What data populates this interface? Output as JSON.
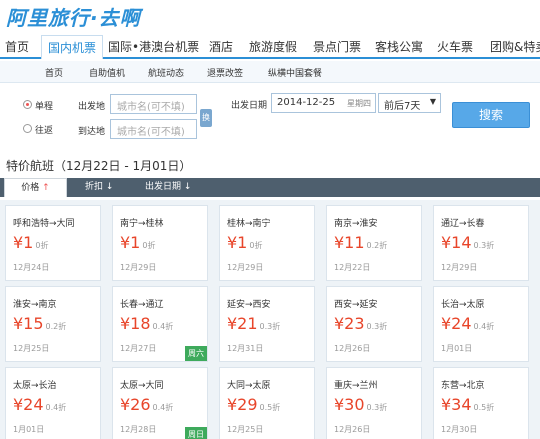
{
  "logo": "阿里旅行·去啊",
  "main_nav": [
    "首页",
    "国内机票",
    "国际•港澳台机票",
    "酒店",
    "旅游度假",
    "景点门票",
    "客栈公寓",
    "火车票",
    "团购&特卖"
  ],
  "sub_nav": [
    "首页",
    "自助值机",
    "航班动态",
    "退票改签",
    "纵横中国套餐"
  ],
  "search": {
    "trip_types": [
      "单程",
      "往返"
    ],
    "selected_trip": "单程",
    "from_label": "出发地",
    "to_label": "到达地",
    "from_placeholder": "城市名(可不填)",
    "to_placeholder": "城市名(可不填)",
    "swap": "换",
    "date_label": "出发日期",
    "date_value": "2014-12-25",
    "weekday": "星期四",
    "range_value": "前后7天",
    "search_button": "搜索"
  },
  "section_title": "特价航班（12月22日 - 1月01日）",
  "sort_tabs": [
    "价格",
    "折扣",
    "出发日期"
  ],
  "deals": [
    {
      "route": "呼和浩特→大同",
      "price": "¥1",
      "discount": "0折",
      "date": "12月24日",
      "badge": ""
    },
    {
      "route": "南宁→桂林",
      "price": "¥1",
      "discount": "0折",
      "date": "12月29日",
      "badge": ""
    },
    {
      "route": "桂林→南宁",
      "price": "¥1",
      "discount": "0折",
      "date": "12月29日",
      "badge": ""
    },
    {
      "route": "南京→淮安",
      "price": "¥11",
      "discount": "0.2折",
      "date": "12月22日",
      "badge": ""
    },
    {
      "route": "通辽→长春",
      "price": "¥14",
      "discount": "0.3折",
      "date": "12月29日",
      "badge": ""
    },
    {
      "route": "淮安→南京",
      "price": "¥15",
      "discount": "0.2折",
      "date": "12月25日",
      "badge": ""
    },
    {
      "route": "长春→通辽",
      "price": "¥18",
      "discount": "0.4折",
      "date": "12月27日",
      "badge": "周六"
    },
    {
      "route": "延安→西安",
      "price": "¥21",
      "discount": "0.3折",
      "date": "12月31日",
      "badge": ""
    },
    {
      "route": "西安→延安",
      "price": "¥23",
      "discount": "0.3折",
      "date": "12月26日",
      "badge": ""
    },
    {
      "route": "长治→太原",
      "price": "¥24",
      "discount": "0.4折",
      "date": "1月01日",
      "badge": ""
    },
    {
      "route": "太原→长治",
      "price": "¥24",
      "discount": "0.4折",
      "date": "1月01日",
      "badge": ""
    },
    {
      "route": "太原→大同",
      "price": "¥26",
      "discount": "0.4折",
      "date": "12月28日",
      "badge": "周日"
    },
    {
      "route": "大同→太原",
      "price": "¥29",
      "discount": "0.5折",
      "date": "12月25日",
      "badge": ""
    },
    {
      "route": "重庆→兰州",
      "price": "¥30",
      "discount": "0.3折",
      "date": "12月26日",
      "badge": ""
    },
    {
      "route": "东营→北京",
      "price": "¥34",
      "discount": "0.5折",
      "date": "12月30日",
      "badge": ""
    }
  ],
  "colors": {
    "brand": "#2b8fd6",
    "price": "#e8452a",
    "sort_bar": "#4e5f6e",
    "badge": "#3eaa5c"
  }
}
